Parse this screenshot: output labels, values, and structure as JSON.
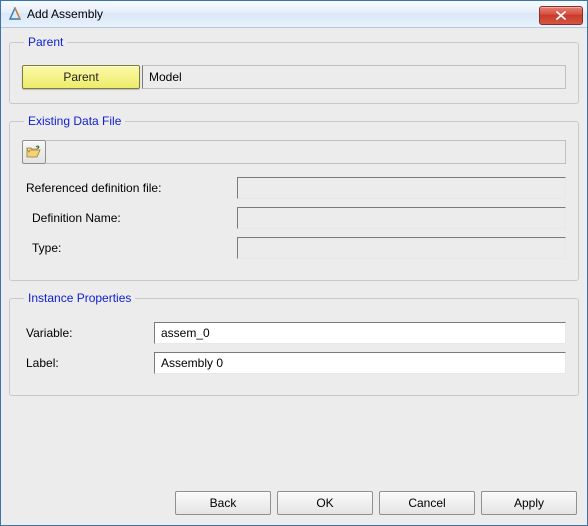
{
  "window": {
    "title": "Add Assembly"
  },
  "parent": {
    "legend": "Parent",
    "button_label": "Parent",
    "value": "Model"
  },
  "existing": {
    "legend": "Existing Data File",
    "ref_label": "Referenced definition file:",
    "ref_value": "",
    "defname_label": "Definition Name:",
    "defname_value": "",
    "type_label": "Type:",
    "type_value": ""
  },
  "instance": {
    "legend": "Instance Properties",
    "variable_label": "Variable:",
    "variable_value": "assem_0",
    "label_label": "Label:",
    "label_value": "Assembly 0"
  },
  "buttons": {
    "back": "Back",
    "ok": "OK",
    "cancel": "Cancel",
    "apply": "Apply"
  }
}
